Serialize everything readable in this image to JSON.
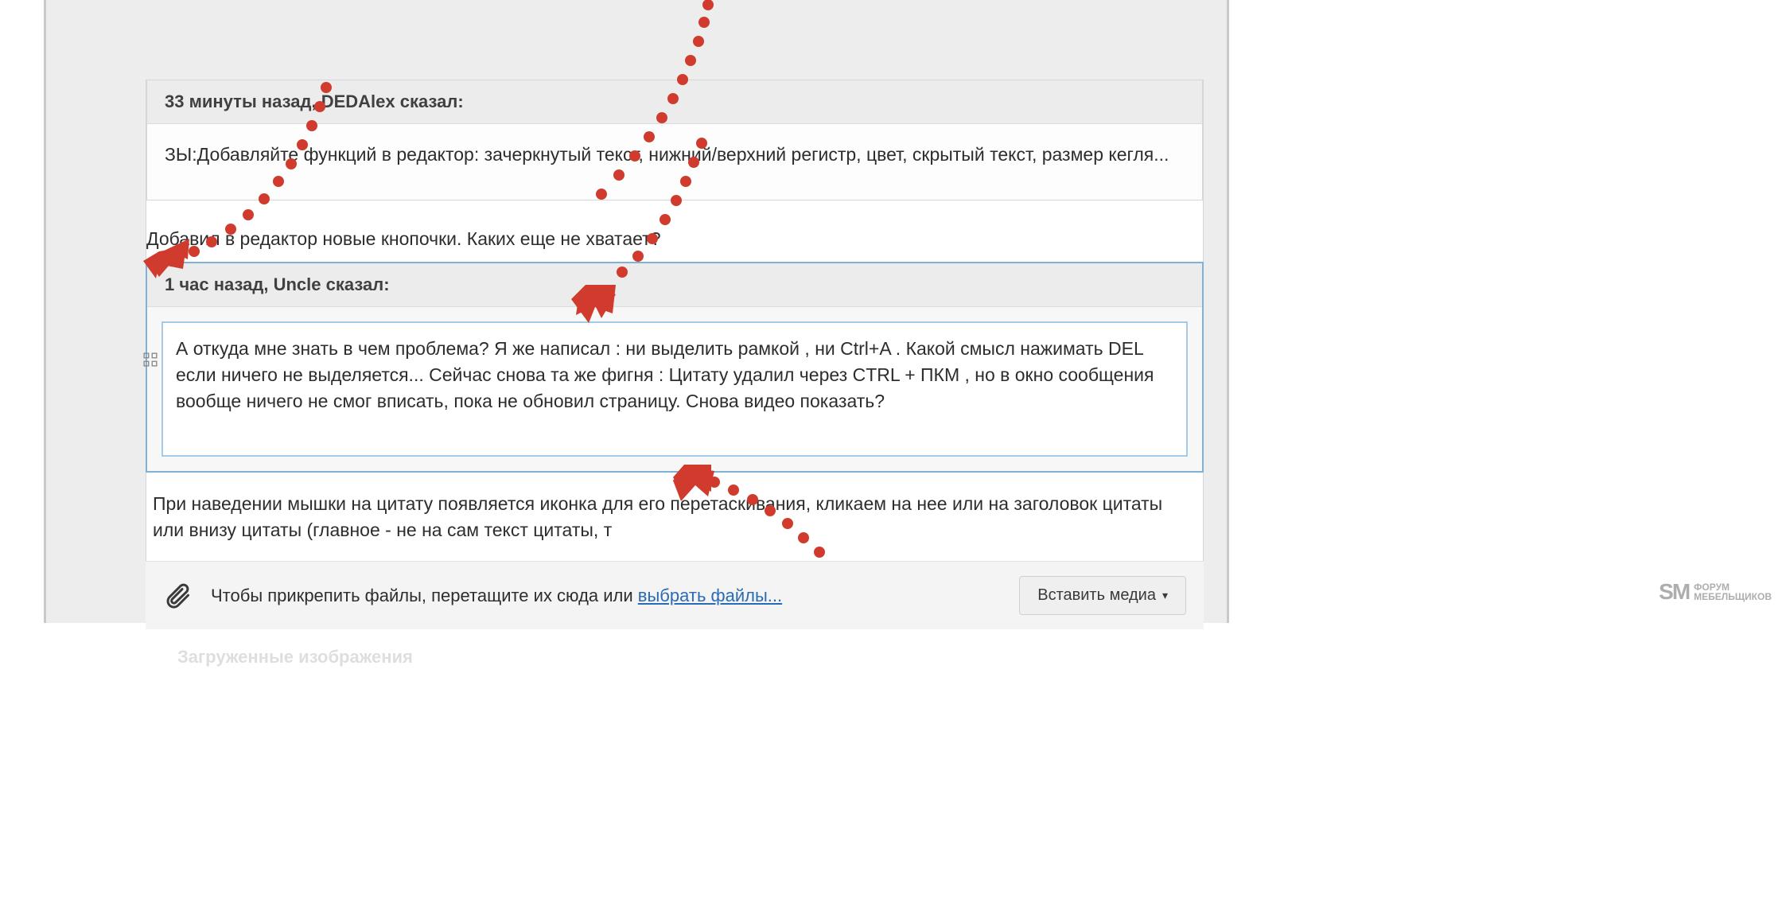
{
  "quotes": [
    {
      "header": "33 минуты назад, DEDAlex сказал:",
      "body": "ЗЫ:Добавляйте функций в редактор: зачеркнутый текст, нижний/верхний регистр, цвет, скрытый текст, размер кегля..."
    },
    {
      "header": "1 час назад, Uncle сказал:",
      "body": "А откуда мне знать в чем проблема? Я же написал : ни выделить рамкой , ни Ctrl+A  . Какой смысл нажимать DEL если ничего не выделяется... Сейчас снова та же фигня : Цитату удалил через CTRL + ПКМ , но в окно сообщения вообще ничего не смог вписать, пока не обновил страницу. Снова видео показать?"
    }
  ],
  "mid_text": "Добавил в редактор новые кнопочки. Каких еще не хватает?",
  "bottom_text": "При наведении мышки на цитату появляется иконка для его перетаскивания, кликаем на нее или на заголовок цитаты или внизу цитаты (главное - не на сам текст цитаты, т",
  "attach": {
    "prefix": "Чтобы прикрепить файлы, перетащите их сюда или ",
    "link": "выбрать файлы..."
  },
  "insert_media": "Вставить медиа",
  "section_below_title": "Загруженные изображения",
  "watermark": {
    "logo": "SM",
    "line1": "ФОРУМ",
    "line2": "МЕБЕЛЬЩИКОВ"
  }
}
